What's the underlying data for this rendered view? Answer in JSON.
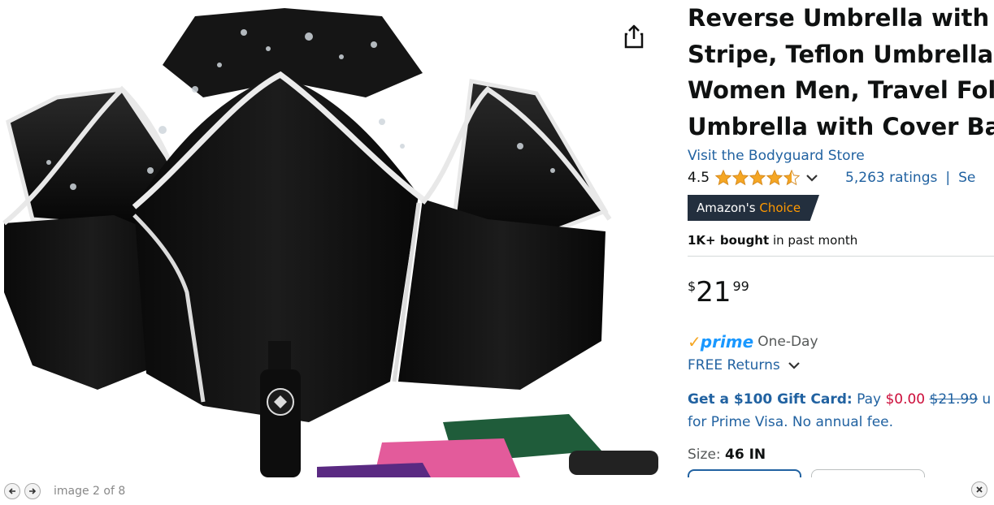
{
  "product": {
    "title_lines": [
      "Reverse Umbrella with R",
      "Stripe, Teflon Umbrella f",
      "Women Men, Travel Fold",
      "Umbrella with Cover Bag"
    ],
    "store_link": "Visit the Bodyguard Store",
    "rating_value": "4.5",
    "rating_stars": 4.5,
    "ratings_count": "5,263 ratings",
    "separator": "|",
    "search_link": "Se",
    "badge_part1": "Amazon's",
    "badge_part2": "Choice",
    "bought_bold": "1K+ bought",
    "bought_rest": " in past month",
    "price_symbol": "$",
    "price_whole": "21",
    "price_fraction": "99",
    "prime_check": "✓",
    "prime_word": "prime",
    "prime_delivery": "One-Day",
    "returns_link": "FREE Returns",
    "gift_bold": "Get a $100 Gift Card:",
    "gift_pay": " Pay ",
    "gift_new_price": "$0.00",
    "gift_old_price": "$21.99",
    "gift_tail": " u",
    "gift_line2": "for Prime Visa. No annual fee.",
    "size_label": "Size: ",
    "size_value": "46 IN"
  },
  "viewer": {
    "counter": "image 2 of 8"
  },
  "colors": {
    "link": "#2162a1",
    "badge_bg": "#232f3e",
    "badge_accent": "#ff9900",
    "star": "#f5a623",
    "prime_blue": "#1a98ff",
    "deal_red": "#cc0c39"
  },
  "icons": {
    "share": "share-icon",
    "prev": "arrow-left-icon",
    "next": "arrow-right-icon",
    "close": "close-icon",
    "chevron": "chevron-down-icon",
    "star": "star-icon"
  }
}
